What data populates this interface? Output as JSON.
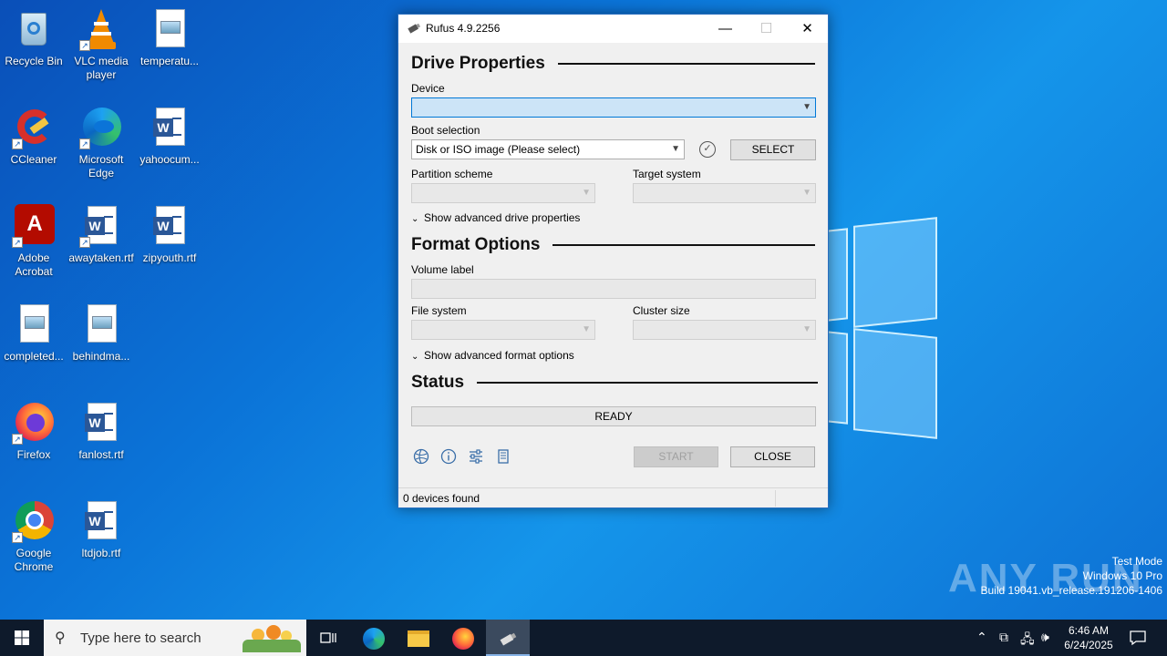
{
  "desktop": {
    "icons": [
      {
        "label": "Recycle Bin",
        "icon": "recycle-bin-icon"
      },
      {
        "label": "VLC media player",
        "icon": "vlc-icon"
      },
      {
        "label": "temperatu...",
        "icon": "image-file-icon"
      },
      {
        "label": "CCleaner",
        "icon": "ccleaner-icon"
      },
      {
        "label": "Microsoft Edge",
        "icon": "edge-icon"
      },
      {
        "label": "yahoocum...",
        "icon": "word-doc-icon"
      },
      {
        "label": "Adobe Acrobat",
        "icon": "acrobat-icon"
      },
      {
        "label": "awaytaken.rtf",
        "icon": "word-doc-icon"
      },
      {
        "label": "zipyouth.rtf",
        "icon": "word-doc-icon"
      },
      {
        "label": "completed...",
        "icon": "image-file-icon"
      },
      {
        "label": "behindma...",
        "icon": "image-file-icon"
      },
      {
        "label": "Firefox",
        "icon": "firefox-icon"
      },
      {
        "label": "fanlost.rtf",
        "icon": "word-doc-icon"
      },
      {
        "label": "Google Chrome",
        "icon": "chrome-icon"
      },
      {
        "label": "ltdjob.rtf",
        "icon": "word-doc-icon"
      }
    ]
  },
  "rufus": {
    "title": "Rufus 4.9.2256",
    "drive_properties": {
      "heading": "Drive Properties",
      "device_label": "Device",
      "device_value": "",
      "boot_selection_label": "Boot selection",
      "boot_selection_value": "Disk or ISO image (Please select)",
      "select_button": "SELECT",
      "partition_scheme_label": "Partition scheme",
      "partition_scheme_value": "",
      "target_system_label": "Target system",
      "target_system_value": "",
      "advanced_toggle": "Show advanced drive properties"
    },
    "format_options": {
      "heading": "Format Options",
      "volume_label_label": "Volume label",
      "volume_label_value": "",
      "file_system_label": "File system",
      "file_system_value": "",
      "cluster_size_label": "Cluster size",
      "cluster_size_value": "",
      "advanced_toggle": "Show advanced format options"
    },
    "status": {
      "heading": "Status",
      "progress_text": "READY",
      "progress_fraction": 0
    },
    "buttons": {
      "start": "START",
      "close": "CLOSE"
    },
    "status_bar": "0 devices found"
  },
  "watermark": {
    "logo": "ANY RUN",
    "line1": "Test Mode",
    "line2": "Windows 10 Pro",
    "line3": "Build 19041.vb_release.191206-1406"
  },
  "taskbar": {
    "search_placeholder": "Type here to search",
    "time": "6:46 AM",
    "date": "6/24/2025"
  }
}
